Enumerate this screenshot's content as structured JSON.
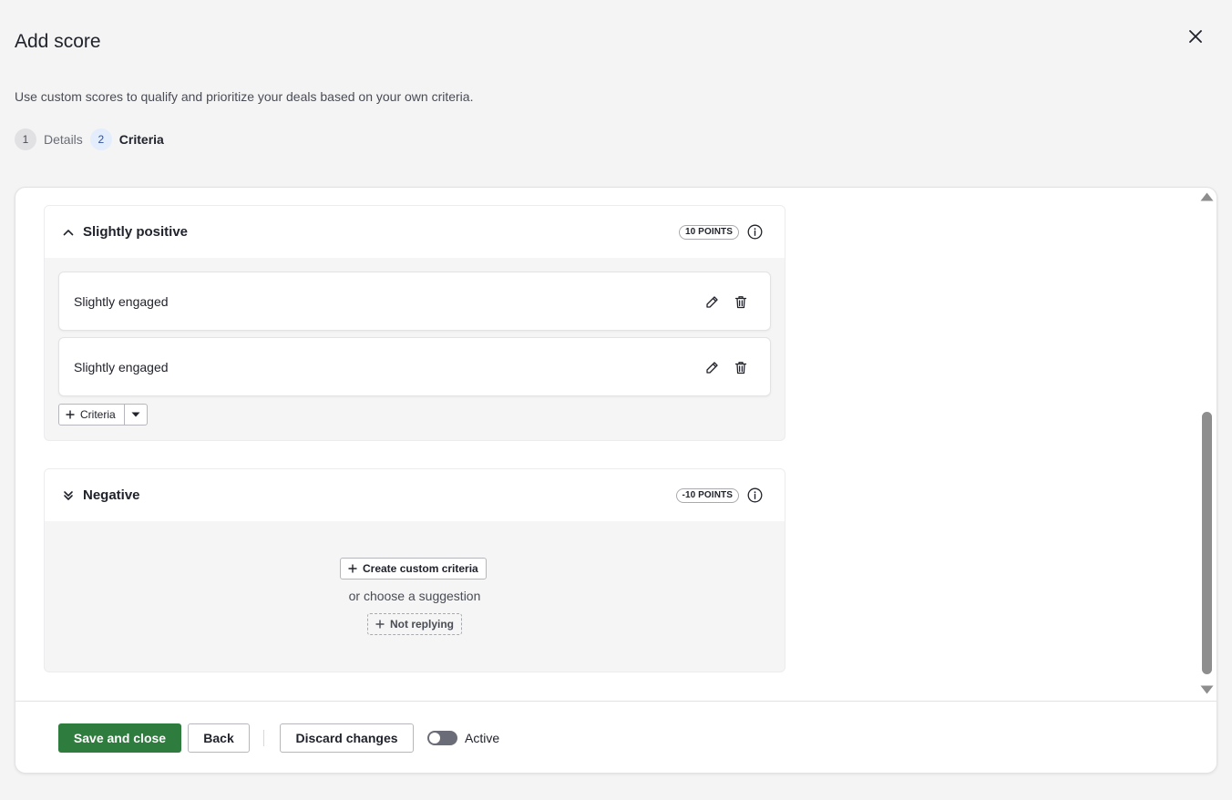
{
  "header": {
    "title": "Add score",
    "subtitle": "Use custom scores to qualify and prioritize your deals based on your own criteria."
  },
  "stepper": {
    "steps": [
      {
        "number": "1",
        "label": "Details",
        "state": "done"
      },
      {
        "number": "2",
        "label": "Criteria",
        "state": "current"
      }
    ]
  },
  "groups": {
    "slightly_positive": {
      "title": "Slightly positive",
      "points": "10 POINTS",
      "criteria": [
        {
          "label": "Slightly engaged"
        },
        {
          "label": "Slightly engaged"
        }
      ],
      "add_criteria_label": "Criteria"
    },
    "negative": {
      "title": "Negative",
      "points": "-10 POINTS",
      "create_label": "Create custom criteria",
      "or_text": "or choose a suggestion",
      "suggestion_label": "Not replying"
    }
  },
  "footer": {
    "save_label": "Save and close",
    "back_label": "Back",
    "discard_label": "Discard changes",
    "toggle_label": "Active",
    "toggle_on": false
  },
  "colors": {
    "primary": "#2e7c3e",
    "current_step_bg": "#e3edfc",
    "current_step_text": "#335195"
  }
}
